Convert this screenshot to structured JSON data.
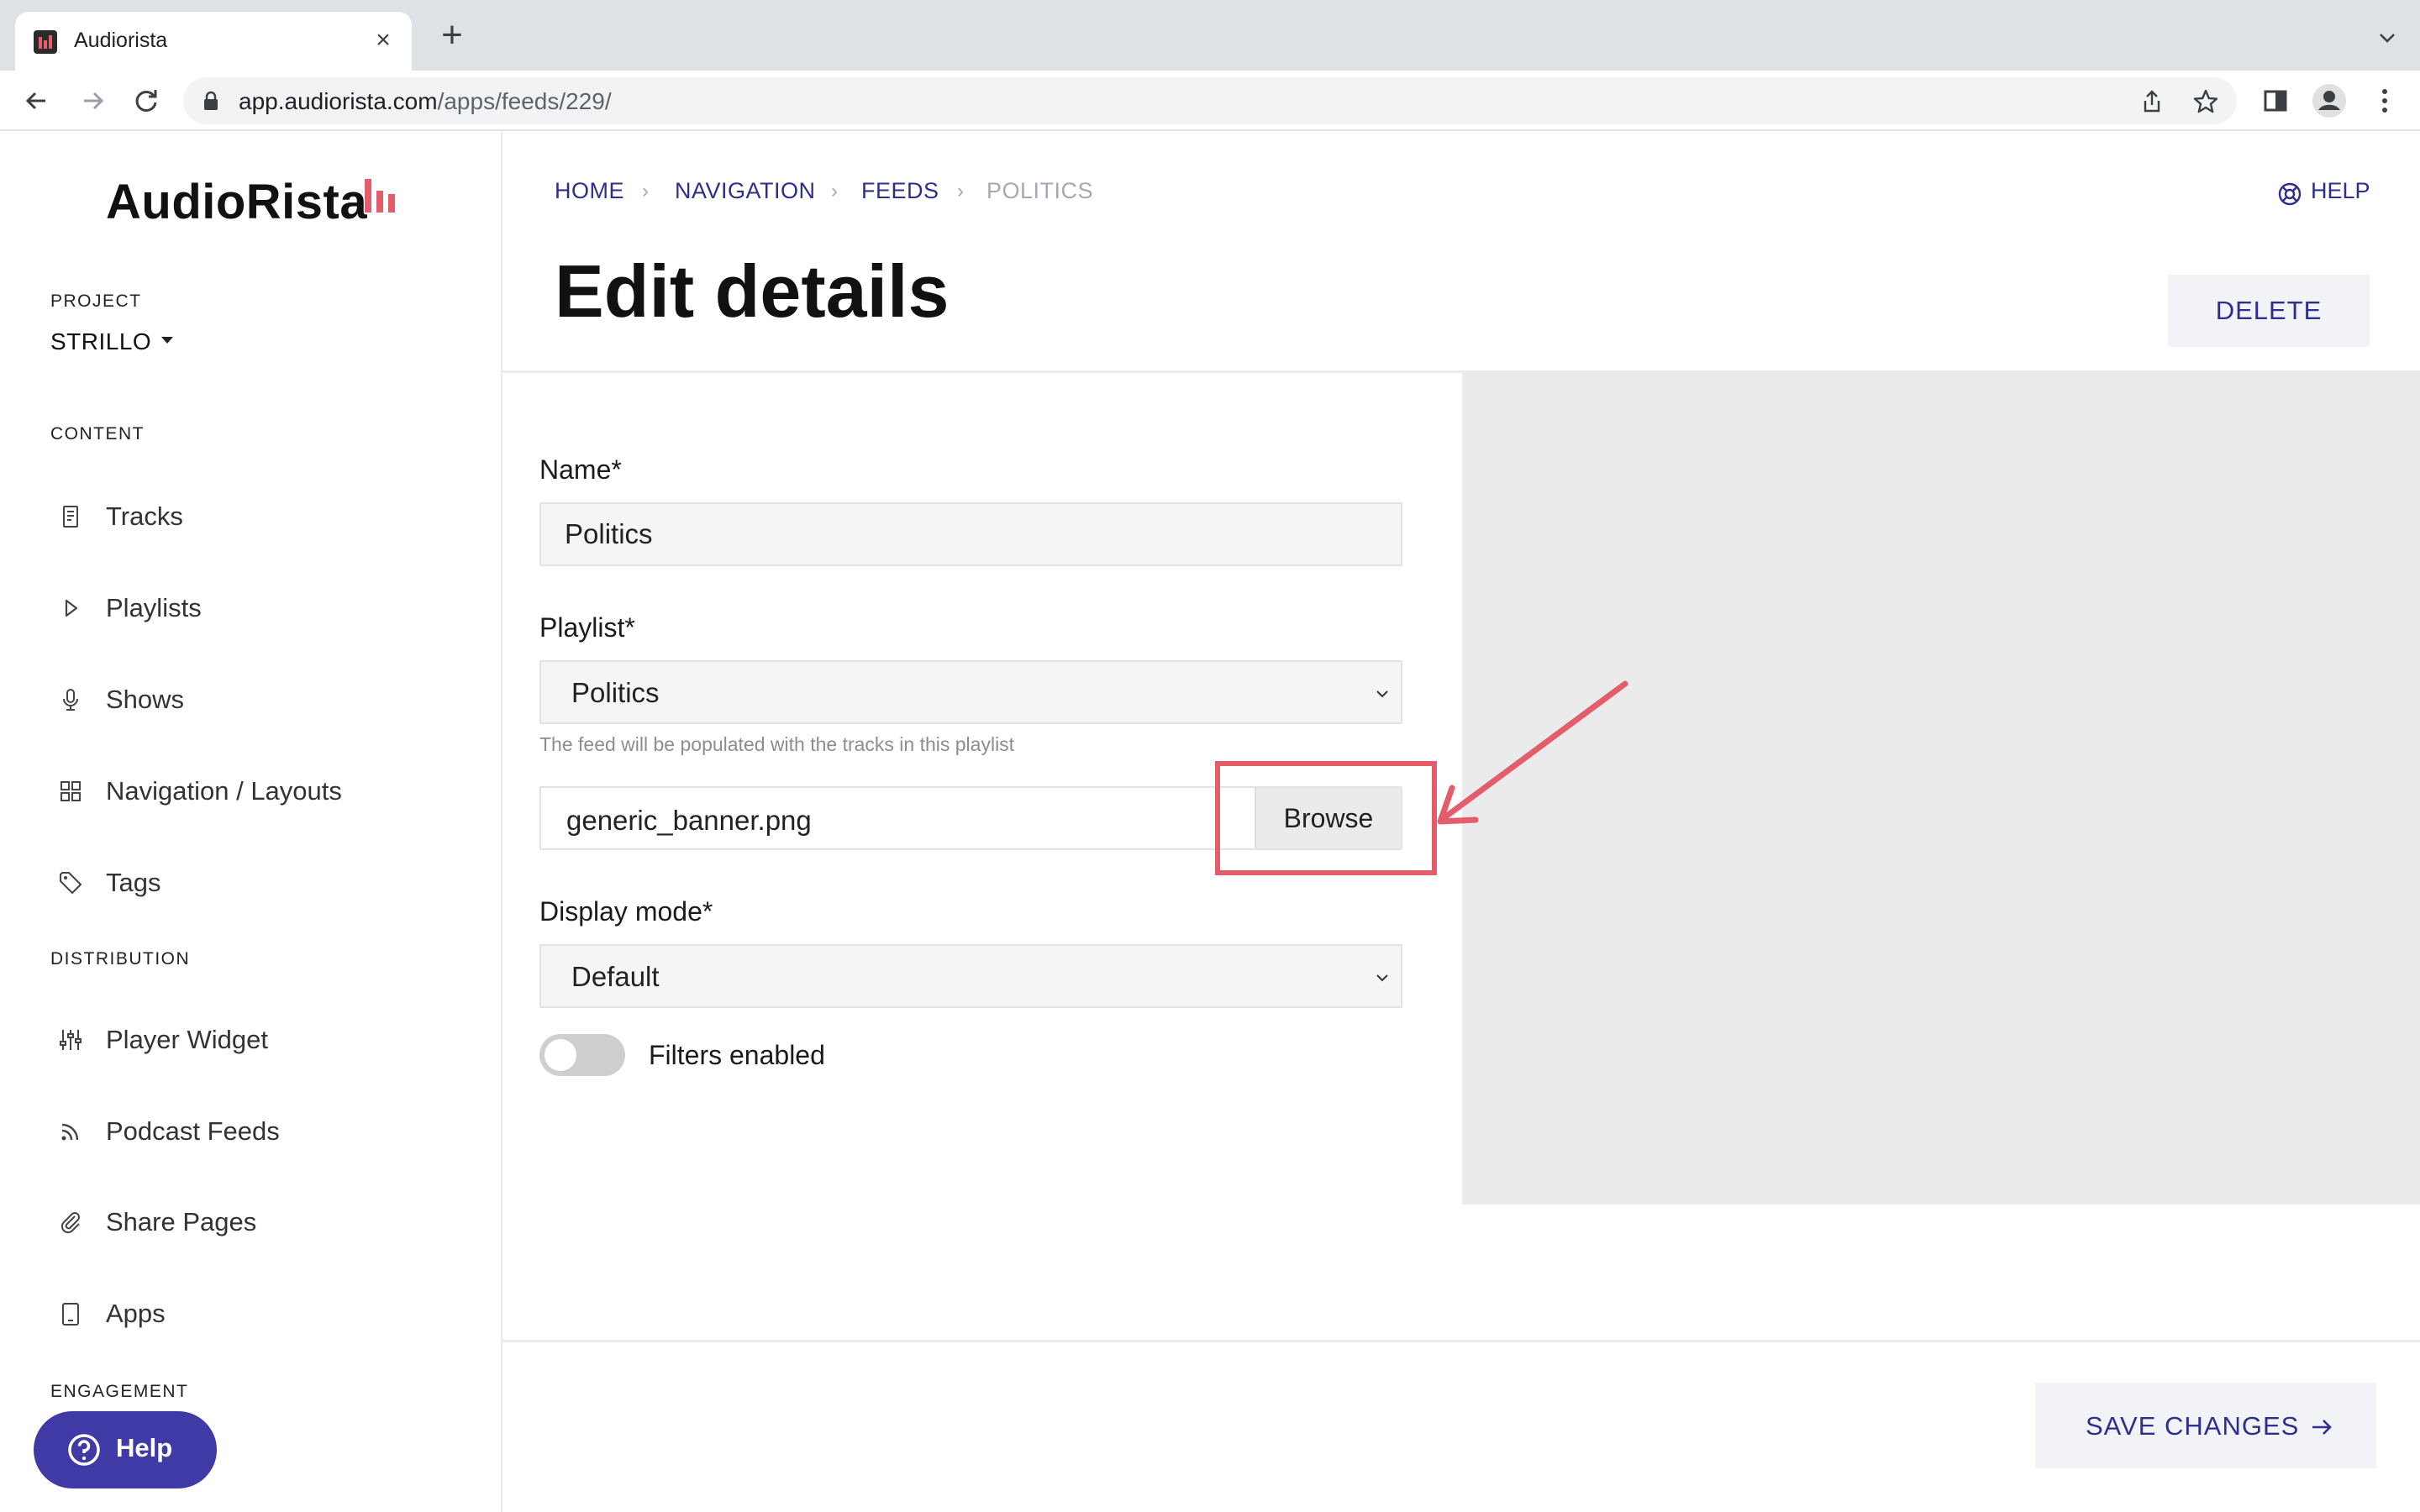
{
  "browser": {
    "tab_title": "Audiorista",
    "url_host": "app.audiorista.com",
    "url_path": "/apps/feeds/229/"
  },
  "sidebar": {
    "logo_text": "AudioRista",
    "project_label": "PROJECT",
    "project_value": "STRILLO",
    "content_label": "CONTENT",
    "content_items": [
      {
        "label": "Tracks",
        "icon": "document-icon"
      },
      {
        "label": "Playlists",
        "icon": "play-icon"
      },
      {
        "label": "Shows",
        "icon": "microphone-icon"
      },
      {
        "label": "Navigation / Layouts",
        "icon": "grid-icon"
      },
      {
        "label": "Tags",
        "icon": "tag-icon"
      }
    ],
    "distribution_label": "DISTRIBUTION",
    "distribution_items": [
      {
        "label": "Player Widget",
        "icon": "sliders-icon"
      },
      {
        "label": "Podcast Feeds",
        "icon": "rss-icon"
      },
      {
        "label": "Share Pages",
        "icon": "paperclip-icon"
      },
      {
        "label": "Apps",
        "icon": "tablet-icon"
      }
    ],
    "engagement_label": "ENGAGEMENT",
    "help_button": "Help"
  },
  "breadcrumb": [
    "HOME",
    "NAVIGATION",
    "FEEDS",
    "POLITICS"
  ],
  "header": {
    "help_link": "HELP",
    "title": "Edit details",
    "delete_button": "DELETE"
  },
  "form": {
    "name_label": "Name*",
    "name_value": "Politics",
    "playlist_label": "Playlist*",
    "playlist_value": "Politics",
    "playlist_help": "The feed will be populated with the tracks in this playlist",
    "image_file": "generic_banner.png",
    "browse_button": "Browse",
    "display_mode_label": "Display mode*",
    "display_mode_value": "Default",
    "filters_label": "Filters enabled",
    "filters_enabled": false
  },
  "footer": {
    "save_button": "SAVE CHANGES"
  },
  "colors": {
    "accent": "#2d2f8c",
    "brand_red": "#e35d6a",
    "help_pill": "#3f3aa6",
    "highlight": "#e35d6a"
  }
}
